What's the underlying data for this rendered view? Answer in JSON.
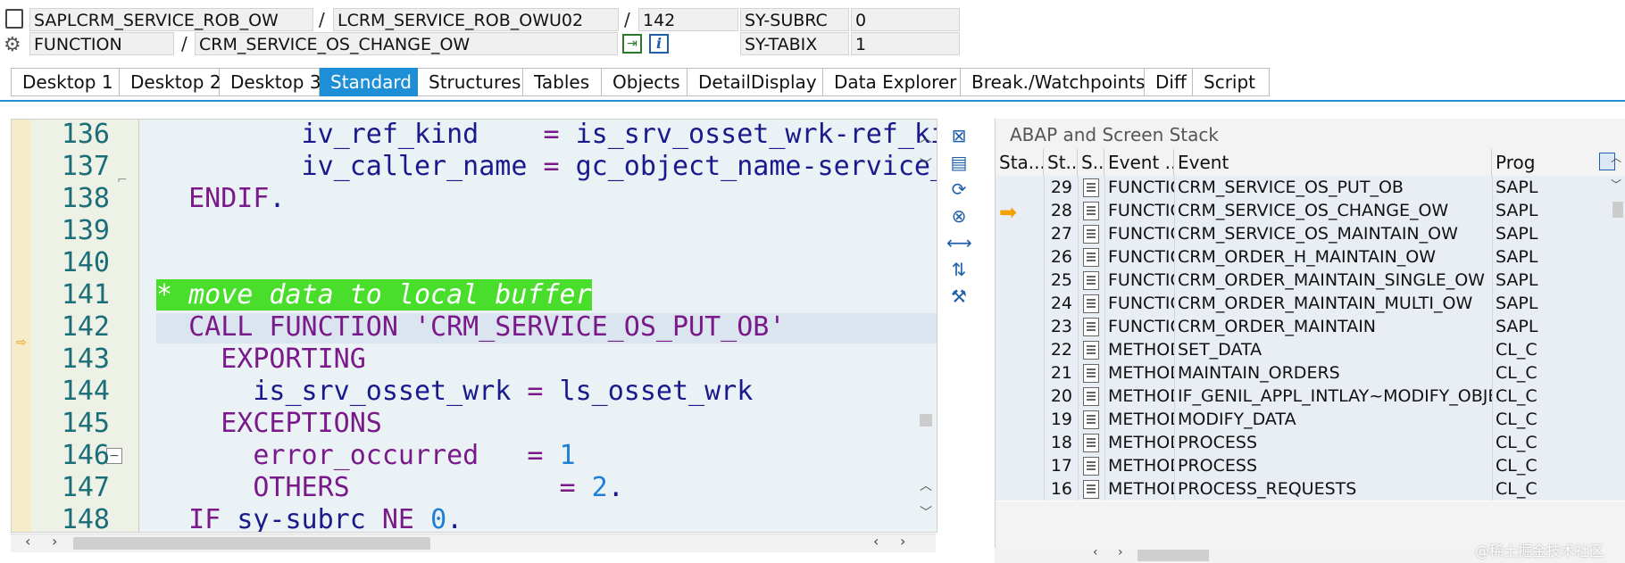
{
  "top_fields": {
    "program": "SAPLCRM_SERVICE_ROB_OW",
    "include": "LCRM_SERVICE_ROB_OWU02",
    "line": "142",
    "subrc_label": "SY-SUBRC",
    "subrc_value": "0",
    "event_type": "FUNCTION",
    "event_name": "CRM_SERVICE_OS_CHANGE_OW",
    "tabix_label": "SY-TABIX",
    "tabix_value": "1",
    "sep": "/"
  },
  "tabs": [
    {
      "label": "Desktop 1",
      "active": false
    },
    {
      "label": "Desktop 2",
      "active": false
    },
    {
      "label": "Desktop 3",
      "active": false
    },
    {
      "label": "Standard",
      "active": true
    },
    {
      "label": "Structures",
      "active": false
    },
    {
      "label": "Tables",
      "active": false
    },
    {
      "label": "Objects",
      "active": false
    },
    {
      "label": "DetailDisplay",
      "active": false
    },
    {
      "label": "Data Explorer",
      "active": false
    },
    {
      "label": "Break./Watchpoints",
      "active": false
    },
    {
      "label": "Diff",
      "active": false
    },
    {
      "label": "Script",
      "active": false
    }
  ],
  "code": {
    "lines": [
      {
        "no": "136",
        "parts": [
          [
            "id",
            "         iv_ref_kind    "
          ],
          [
            "op",
            "= "
          ],
          [
            "id",
            "is_srv_osset_wrk-ref_ki"
          ]
        ]
      },
      {
        "no": "137",
        "parts": [
          [
            "id",
            "         iv_caller_name "
          ],
          [
            "op",
            "= "
          ],
          [
            "id",
            "gc_object_name-service_"
          ]
        ]
      },
      {
        "no": "138",
        "parts": [
          [
            "kw",
            "  ENDIF"
          ],
          [
            "id",
            "."
          ]
        ]
      },
      {
        "no": "139",
        "parts": []
      },
      {
        "no": "140",
        "parts": []
      },
      {
        "no": "141",
        "parts": [
          [
            "comment",
            "* move data to local buffer"
          ]
        ]
      },
      {
        "no": "142",
        "parts": [
          [
            "kw",
            "  CALL FUNCTION "
          ],
          [
            "str",
            "'CRM_SERVICE_OS_PUT_OB'"
          ]
        ],
        "current": true
      },
      {
        "no": "143",
        "parts": [
          [
            "kw",
            "    EXPORTING"
          ]
        ]
      },
      {
        "no": "144",
        "parts": [
          [
            "id",
            "      is_srv_osset_wrk "
          ],
          [
            "op",
            "= "
          ],
          [
            "id",
            "ls_osset_wrk"
          ]
        ]
      },
      {
        "no": "145",
        "parts": [
          [
            "kw",
            "    EXCEPTIONS"
          ]
        ]
      },
      {
        "no": "146",
        "parts": [
          [
            "kw",
            "      error_occurred   "
          ],
          [
            "op",
            "= "
          ],
          [
            "num",
            "1"
          ]
        ]
      },
      {
        "no": "147",
        "parts": [
          [
            "kw",
            "      OTHERS           "
          ],
          [
            "op",
            "  = "
          ],
          [
            "num",
            "2"
          ],
          [
            "id",
            "."
          ]
        ]
      },
      {
        "no": "148",
        "parts": [
          [
            "kw",
            "  IF "
          ],
          [
            "id",
            "sy-subrc "
          ],
          [
            "kw",
            "NE "
          ],
          [
            "num",
            "0"
          ],
          [
            "id",
            "."
          ]
        ]
      }
    ]
  },
  "stack": {
    "title": "ABAP and Screen Stack",
    "headers": [
      "Sta...",
      "St...",
      "S..",
      "Event ...",
      "Event",
      "Prog"
    ],
    "rows": [
      {
        "level": "29",
        "type": "FUNCTIO",
        "event": "CRM_SERVICE_OS_PUT_OB",
        "prog": "SAPL",
        "current": false
      },
      {
        "level": "28",
        "type": "FUNCTIO",
        "event": "CRM_SERVICE_OS_CHANGE_OW",
        "prog": "SAPL",
        "current": true
      },
      {
        "level": "27",
        "type": "FUNCTIO",
        "event": "CRM_SERVICE_OS_MAINTAIN_OW",
        "prog": "SAPL",
        "current": false
      },
      {
        "level": "26",
        "type": "FUNCTIO",
        "event": "CRM_ORDER_H_MAINTAIN_OW",
        "prog": "SAPL",
        "current": false
      },
      {
        "level": "25",
        "type": "FUNCTIO",
        "event": "CRM_ORDER_MAINTAIN_SINGLE_OW",
        "prog": "SAPL",
        "current": false
      },
      {
        "level": "24",
        "type": "FUNCTIO",
        "event": "CRM_ORDER_MAINTAIN_MULTI_OW",
        "prog": "SAPL",
        "current": false
      },
      {
        "level": "23",
        "type": "FUNCTIO",
        "event": "CRM_ORDER_MAINTAIN",
        "prog": "SAPL",
        "current": false
      },
      {
        "level": "22",
        "type": "METHOD",
        "event": "SET_DATA",
        "prog": "CL_C",
        "current": false
      },
      {
        "level": "21",
        "type": "METHOD",
        "event": "MAINTAIN_ORDERS",
        "prog": "CL_C",
        "current": false
      },
      {
        "level": "20",
        "type": "METHOD",
        "event": "IF_GENIL_APPL_INTLAY~MODIFY_OBJECTS",
        "prog": "CL_C",
        "current": false
      },
      {
        "level": "19",
        "type": "METHOD",
        "event": "MODIFY_DATA",
        "prog": "CL_C",
        "current": false
      },
      {
        "level": "18",
        "type": "METHOD",
        "event": "PROCESS",
        "prog": "CL_C",
        "current": false
      },
      {
        "level": "17",
        "type": "METHOD",
        "event": "PROCESS",
        "prog": "CL_C",
        "current": false
      },
      {
        "level": "16",
        "type": "METHOD",
        "event": "PROCESS_REQUESTS",
        "prog": "CL_C",
        "current": false
      }
    ]
  },
  "watermark": "@稀土掘金技术社区",
  "colors": {
    "accent": "#1e8fd6",
    "comment_bg": "#4ade2c",
    "current_arrow": "#f2a100"
  }
}
